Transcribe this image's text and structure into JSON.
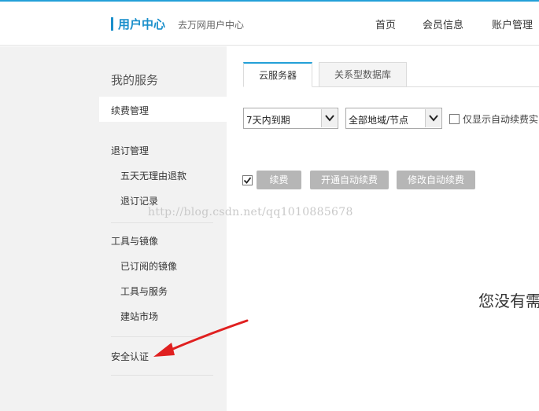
{
  "header": {
    "brand_title": "用户中心",
    "brand_sub": "去万网用户中心",
    "nav": [
      "首页",
      "会员信息",
      "账户管理"
    ],
    "accent_color": "#1a8fcb"
  },
  "sidebar": {
    "heading": "我的服务",
    "active_item": "续费管理",
    "groups": [
      {
        "title": "退订管理",
        "items": [
          "五天无理由退款",
          "退订记录"
        ]
      },
      {
        "title": "工具与镜像",
        "items": [
          "已订阅的镜像",
          "工具与服务",
          "建站市场"
        ]
      },
      {
        "title": "安全认证",
        "items": []
      }
    ]
  },
  "main": {
    "tabs": [
      "云服务器",
      "关系型数据库"
    ],
    "filters": {
      "expiry_select": "7天内到期",
      "region_select": "全部地域/节点",
      "auto_renew_checkbox_label": "仅显示自动续费实"
    },
    "buttons": [
      "续费",
      "开通自动续费",
      "修改自动续费"
    ],
    "select_all_checked": true,
    "empty_text": "您没有需"
  },
  "watermark": "http://blog.csdn.net/qq1010885678",
  "annotation": {
    "arrow_color": "#e02020"
  }
}
